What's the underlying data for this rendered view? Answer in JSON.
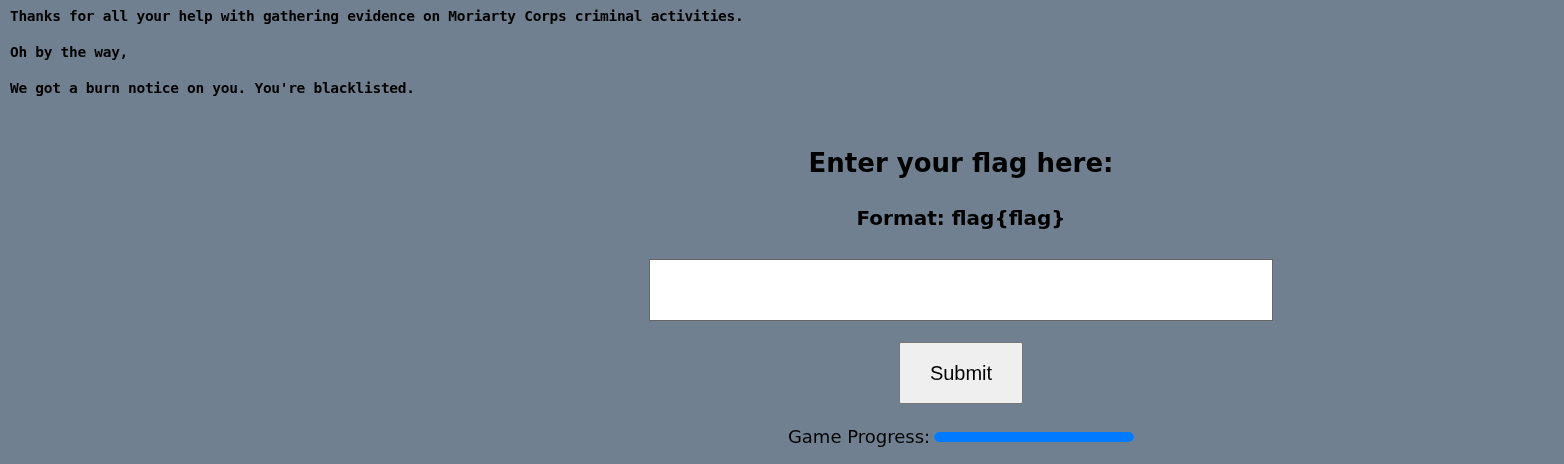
{
  "messages": [
    "Thanks for all your help with gathering evidence on Moriarty Corps criminal activities.",
    "Oh by the way,",
    "We got a burn notice on you. You're blacklisted."
  ],
  "form": {
    "heading": "Enter your flag here:",
    "format": "Format: flag{flag}",
    "button": "Submit"
  },
  "progress": {
    "label": "Game Progress:",
    "level": 1
  }
}
